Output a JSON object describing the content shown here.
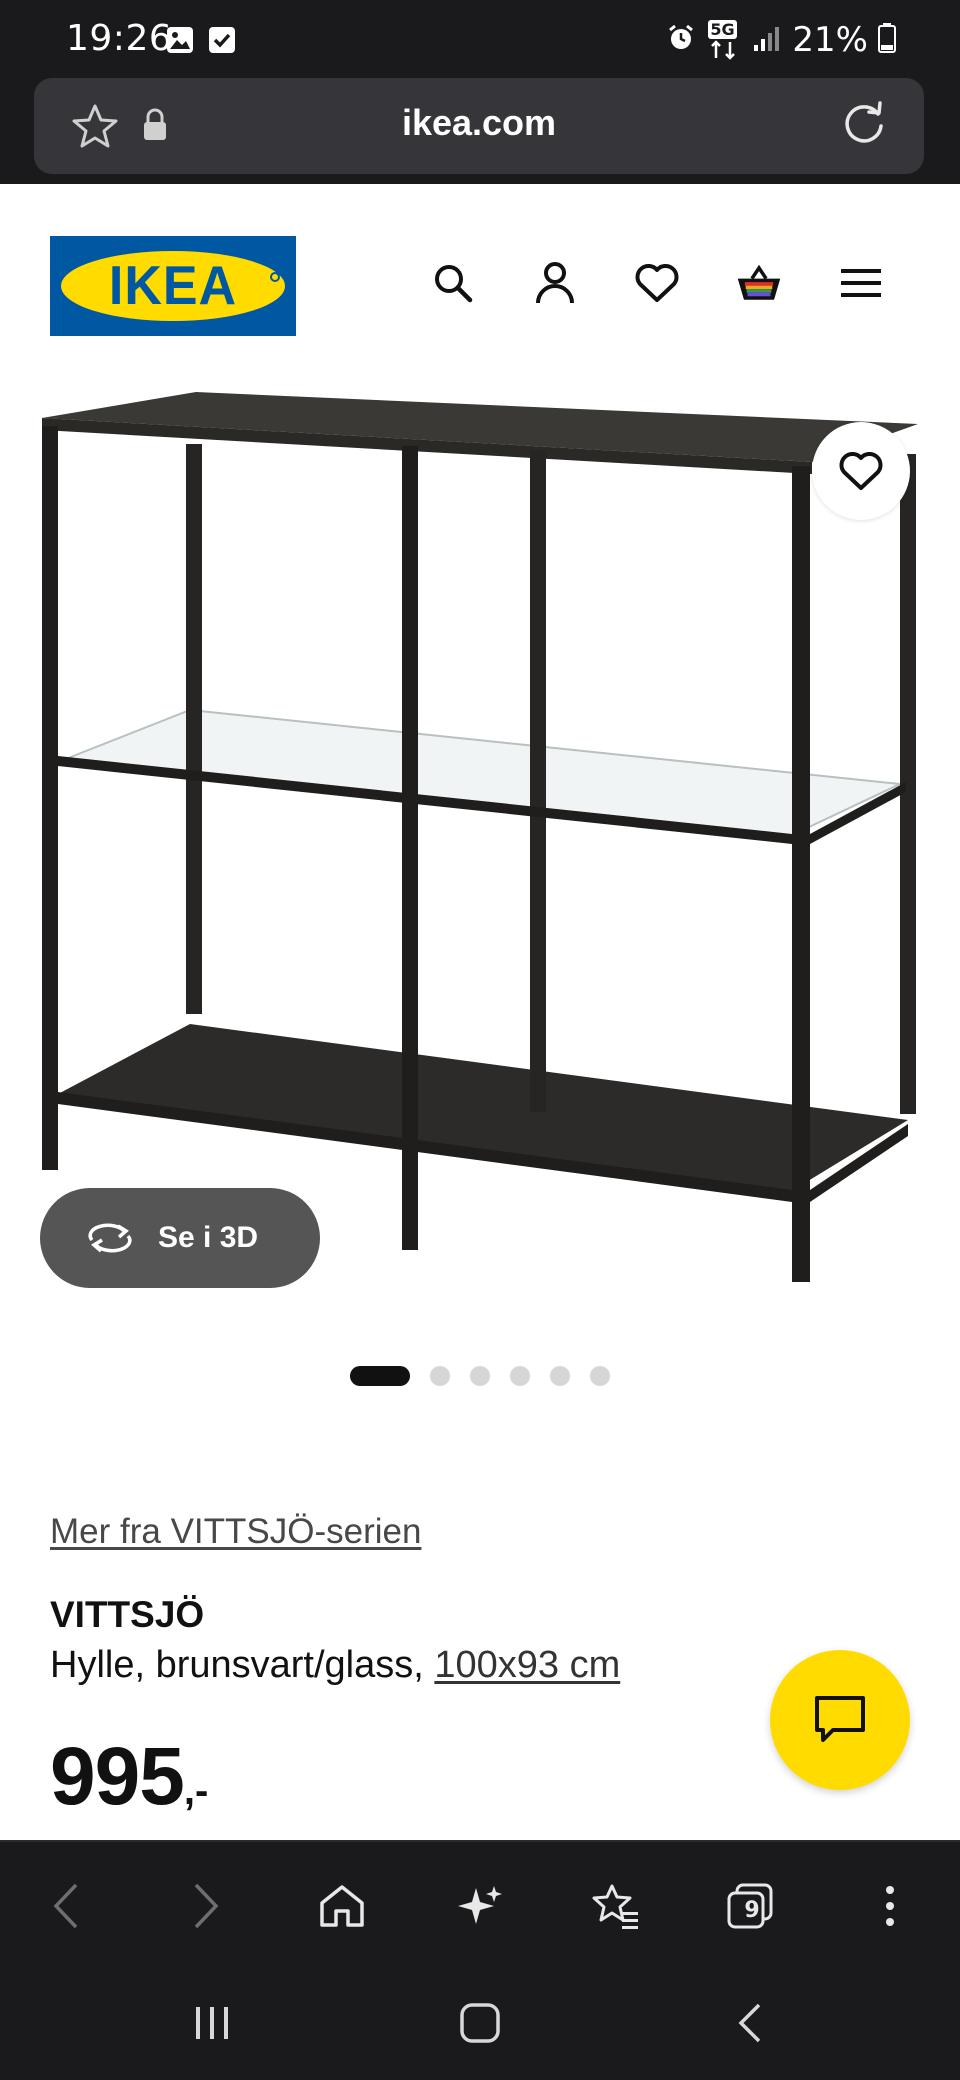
{
  "status_bar": {
    "time": "19:26",
    "network": "5G",
    "battery": "21%",
    "left_icons": [
      "gallery-icon",
      "checkbox-icon"
    ],
    "right_icons": [
      "alarm-icon",
      "5g-icon",
      "signal-icon",
      "battery-icon"
    ]
  },
  "browser": {
    "url": "ikea.com",
    "tab_count": "9",
    "toolbar": [
      "back-icon",
      "forward-icon",
      "home-icon",
      "sparkle-icon",
      "bookmarks-icon",
      "tabs-icon",
      "more-icon"
    ]
  },
  "header": {
    "logo_text": "IKEA",
    "icons": [
      "search-icon",
      "account-icon",
      "wishlist-icon",
      "cart-icon",
      "menu-icon"
    ]
  },
  "product": {
    "series_link": "Mer fra VITTSJÖ-serien",
    "name": "VITTSJÖ",
    "description": "Hylle, brunsvart/glass, ",
    "dimensions": "100x93 cm",
    "price": "995",
    "price_suffix": ",-",
    "view_3d_label": "Se i 3D",
    "image_count": 6,
    "active_image": 1
  },
  "colors": {
    "ikea_blue": "#0058a3",
    "ikea_yellow": "#ffdb00",
    "dark_bar": "#1a1a1c"
  }
}
